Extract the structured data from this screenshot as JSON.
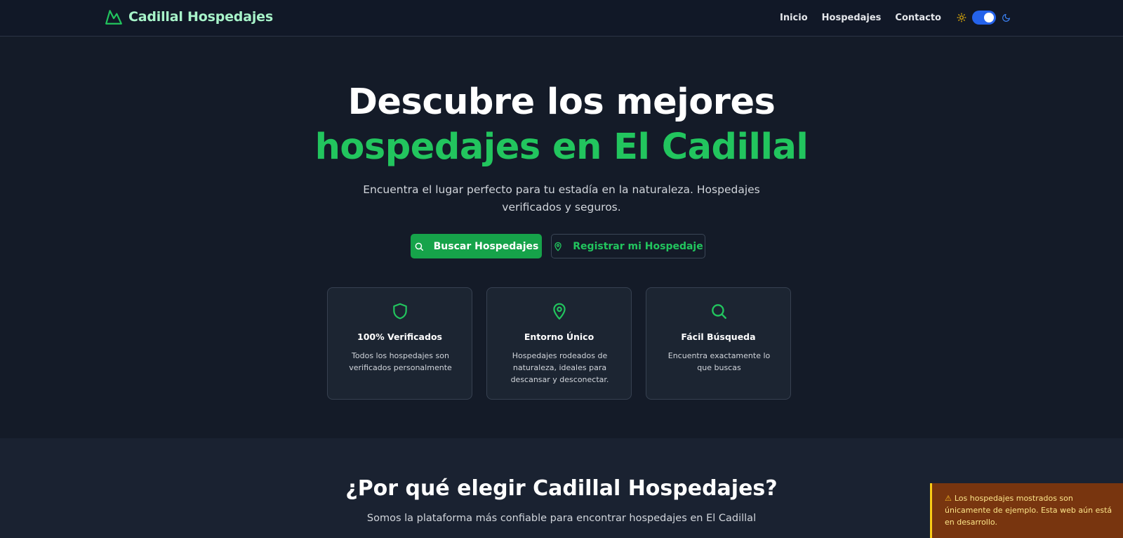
{
  "navbar": {
    "brand": "Cadillal Hospedajes",
    "brand_icon": "mountain-icon",
    "links": [
      "Inicio",
      "Hospedajes",
      "Contacto"
    ],
    "theme_toggle": {
      "state": "dark",
      "sun_icon": "sun-icon",
      "moon_icon": "moon-icon"
    }
  },
  "hero": {
    "title_line1": "Descubre los mejores",
    "title_line2": "hospedajes en El Cadillal",
    "subtitle": "Encuentra el lugar perfecto para tu estadía en la naturaleza. Hospedajes verificados y seguros.",
    "primary_button": "Buscar Hospedajes",
    "secondary_button": "Registrar mi Hospedaje"
  },
  "features": [
    {
      "icon": "shield-icon",
      "title": "100% Verificados",
      "description": "Todos los hospedajes son verificados personalmente"
    },
    {
      "icon": "map-pin-icon",
      "title": "Entorno Único",
      "description": "Hospedajes rodeados de naturaleza, ideales para descansar y desconectar."
    },
    {
      "icon": "search-icon",
      "title": "Fácil Búsqueda",
      "description": "Encuentra exactamente lo que buscas"
    }
  ],
  "why": {
    "title": "¿Por qué elegir Cadillal Hospedajes?",
    "subtitle": "Somos la plataforma más confiable para encontrar hospedajes en El Cadillal"
  },
  "toast": {
    "icon": "warning-icon",
    "message": "Los hospedajes mostrados son únicamente de ejemplo. Esta web aún está en desarrollo."
  },
  "colors": {
    "background": "#111827",
    "accent_green": "#22c55e",
    "button_green": "#16a34a",
    "toggle_blue": "#2563eb",
    "toast_bg": "#78350f",
    "toast_text": "#fde68a"
  }
}
